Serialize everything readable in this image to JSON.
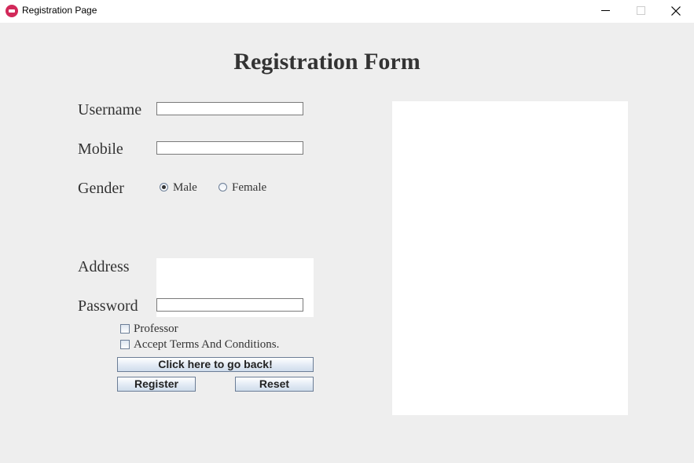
{
  "window": {
    "title": "Registration Page"
  },
  "form": {
    "title": "Registration Form",
    "username_label": "Username",
    "username_value": "",
    "mobile_label": "Mobile",
    "mobile_value": "",
    "gender_label": "Gender",
    "gender_options": [
      {
        "label": "Male",
        "selected": true
      },
      {
        "label": "Female",
        "selected": false
      }
    ],
    "address_label": "Address",
    "address_value": "",
    "password_label": "Password",
    "password_value": "",
    "professor_label": "Professor",
    "professor_checked": false,
    "terms_label": "Accept Terms And Conditions.",
    "terms_checked": false
  },
  "buttons": {
    "back": "Click here to go back!",
    "register": "Register",
    "reset": "Reset"
  },
  "colors": {
    "accent_icon": "#d2295a",
    "background": "#eeeeee",
    "text": "#333333"
  },
  "icons": {
    "app": "app-icon",
    "minimize": "minimize-icon",
    "maximize": "maximize-icon",
    "close": "close-icon"
  }
}
